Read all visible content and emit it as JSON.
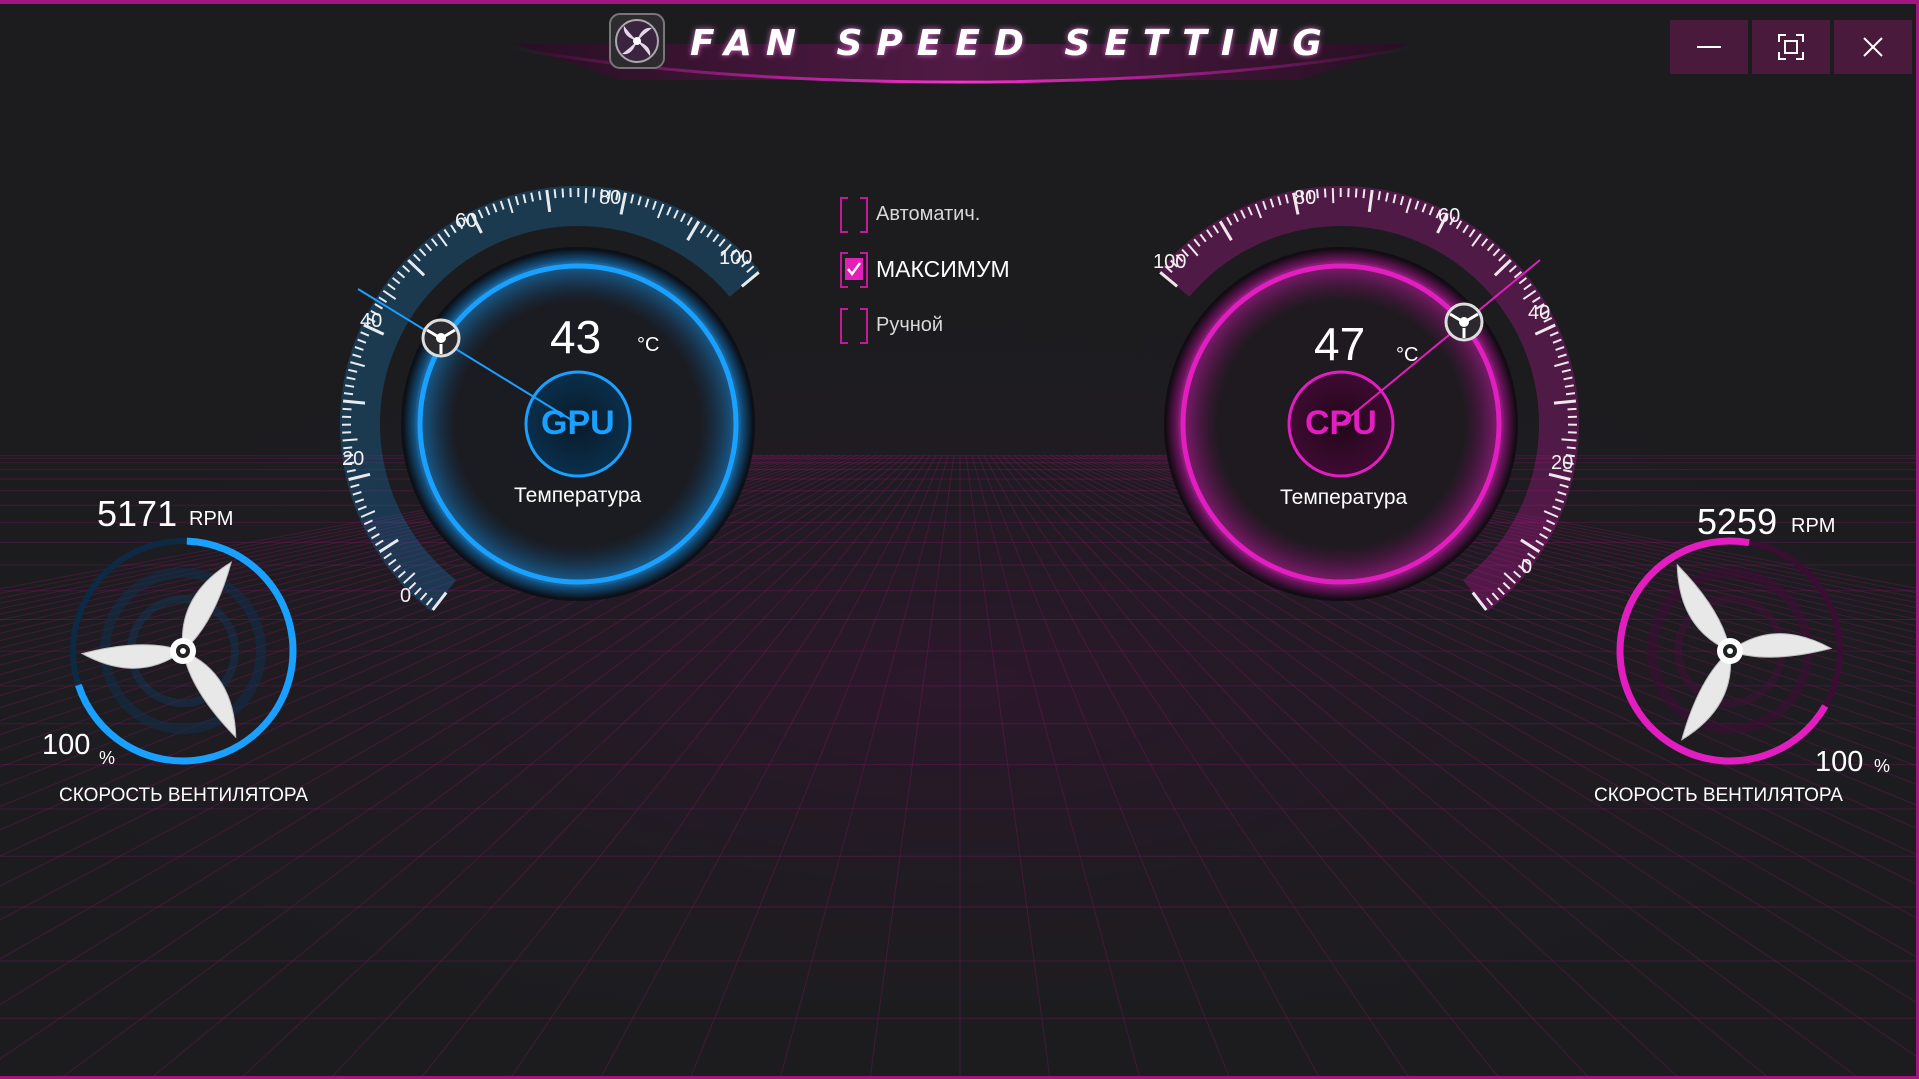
{
  "window": {
    "title": "FAN SPEED SETTING",
    "controls": {
      "minimize": "minimize",
      "maximize": "maximize",
      "close": "close"
    }
  },
  "colors": {
    "background": "#1c1c1f",
    "gpu_accent": "#1aa0ff",
    "cpu_accent": "#e21ec0",
    "title_accent": "#d21aa8"
  },
  "modes": [
    {
      "label": "Автоматич.",
      "checked": false
    },
    {
      "label": "МАКСИМУМ",
      "checked": true
    },
    {
      "label": "Ручной",
      "checked": false
    }
  ],
  "gpu": {
    "chip": "GPU",
    "temperature": "43",
    "temp_unit": "°C",
    "temp_label": "Температура",
    "scale_ticks": [
      "0",
      "20",
      "40",
      "60",
      "80",
      "100"
    ],
    "fan_rpm": "5171",
    "rpm_unit": "RPM",
    "fan_percent": "100",
    "percent_unit": "%",
    "fan_label": "СКОРОСТЬ ВЕНТИЛЯТОРА"
  },
  "cpu": {
    "chip": "CPU",
    "temperature": "47",
    "temp_unit": "°C",
    "temp_label": "Температура",
    "scale_ticks": [
      "0",
      "20",
      "40",
      "60",
      "80",
      "100"
    ],
    "fan_rpm": "5259",
    "rpm_unit": "RPM",
    "fan_percent": "100",
    "percent_unit": "%",
    "fan_label": "СКОРОСТЬ ВЕНТИЛЯТОРА"
  }
}
